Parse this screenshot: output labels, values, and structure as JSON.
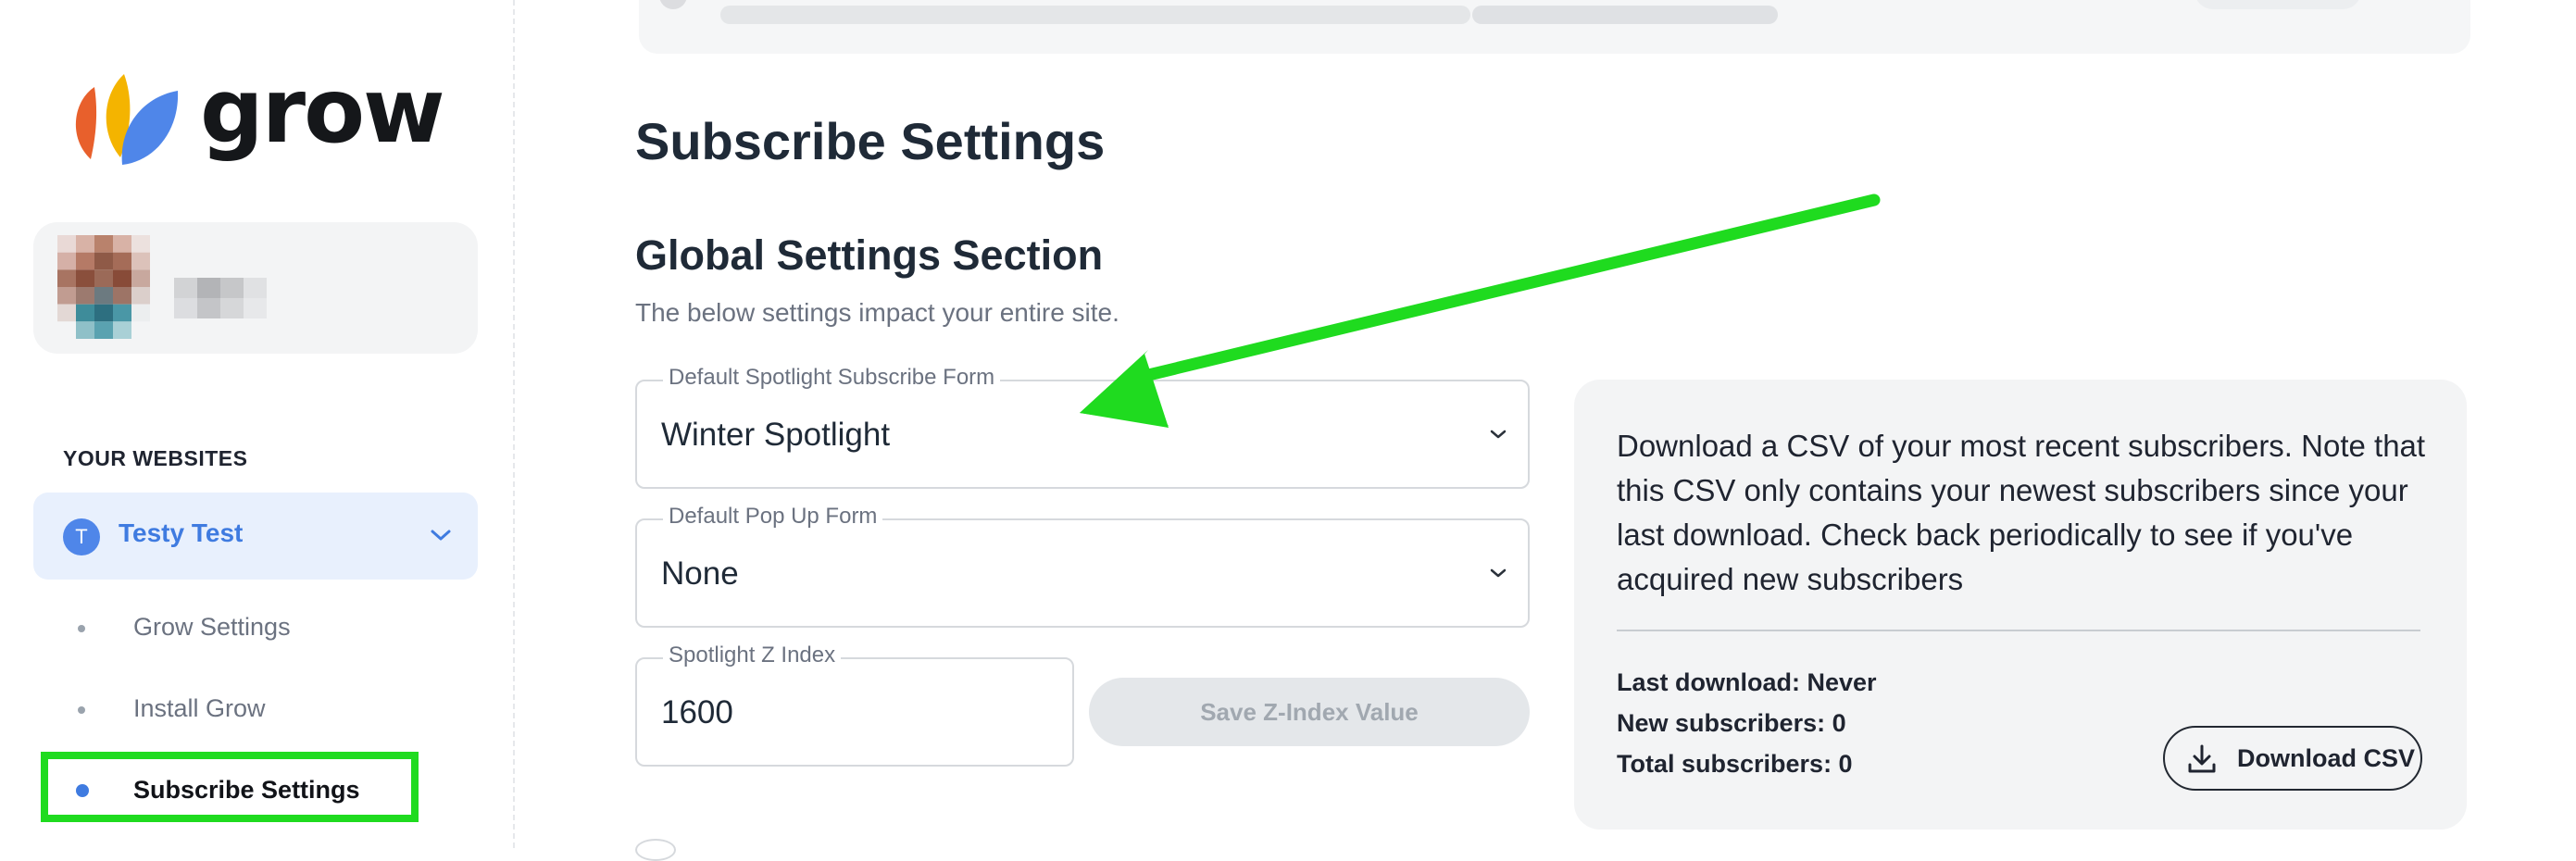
{
  "sidebar": {
    "logo_text": "grow",
    "section_label": "YOUR WEBSITES",
    "site": {
      "initial": "T",
      "name": "Testy Test"
    },
    "nav": [
      {
        "label": "Grow Settings",
        "active": false
      },
      {
        "label": "Install Grow",
        "active": false
      },
      {
        "label": "Subscribe Settings",
        "active": true
      }
    ]
  },
  "main": {
    "title": "Subscribe Settings",
    "section": {
      "title": "Global Settings Section",
      "description": "The below settings impact your entire site."
    },
    "fields": {
      "spotlight_form": {
        "label": "Default Spotlight Subscribe Form",
        "value": "Winter Spotlight"
      },
      "popup_form": {
        "label": "Default Pop Up Form",
        "value": "None"
      },
      "z_index": {
        "label": "Spotlight Z Index",
        "value": "1600"
      }
    },
    "save_button": "Save Z-Index Value",
    "csv": {
      "description": "Download a CSV of your most recent subscribers. Note that this CSV only contains your newest subscribers since your last download. Check back periodically to see if you've acquired new subscribers",
      "last_download": "Last download: Never",
      "new_subscribers": "New subscribers: 0",
      "total_subscribers": "Total subscribers: 0",
      "download_button": "Download CSV"
    }
  },
  "colors": {
    "accent_blue": "#3f7be0",
    "highlight_green": "#1fdb1f",
    "logo_orange": "#e8602c",
    "logo_yellow": "#f4b400",
    "logo_blue": "#4f86e9"
  }
}
